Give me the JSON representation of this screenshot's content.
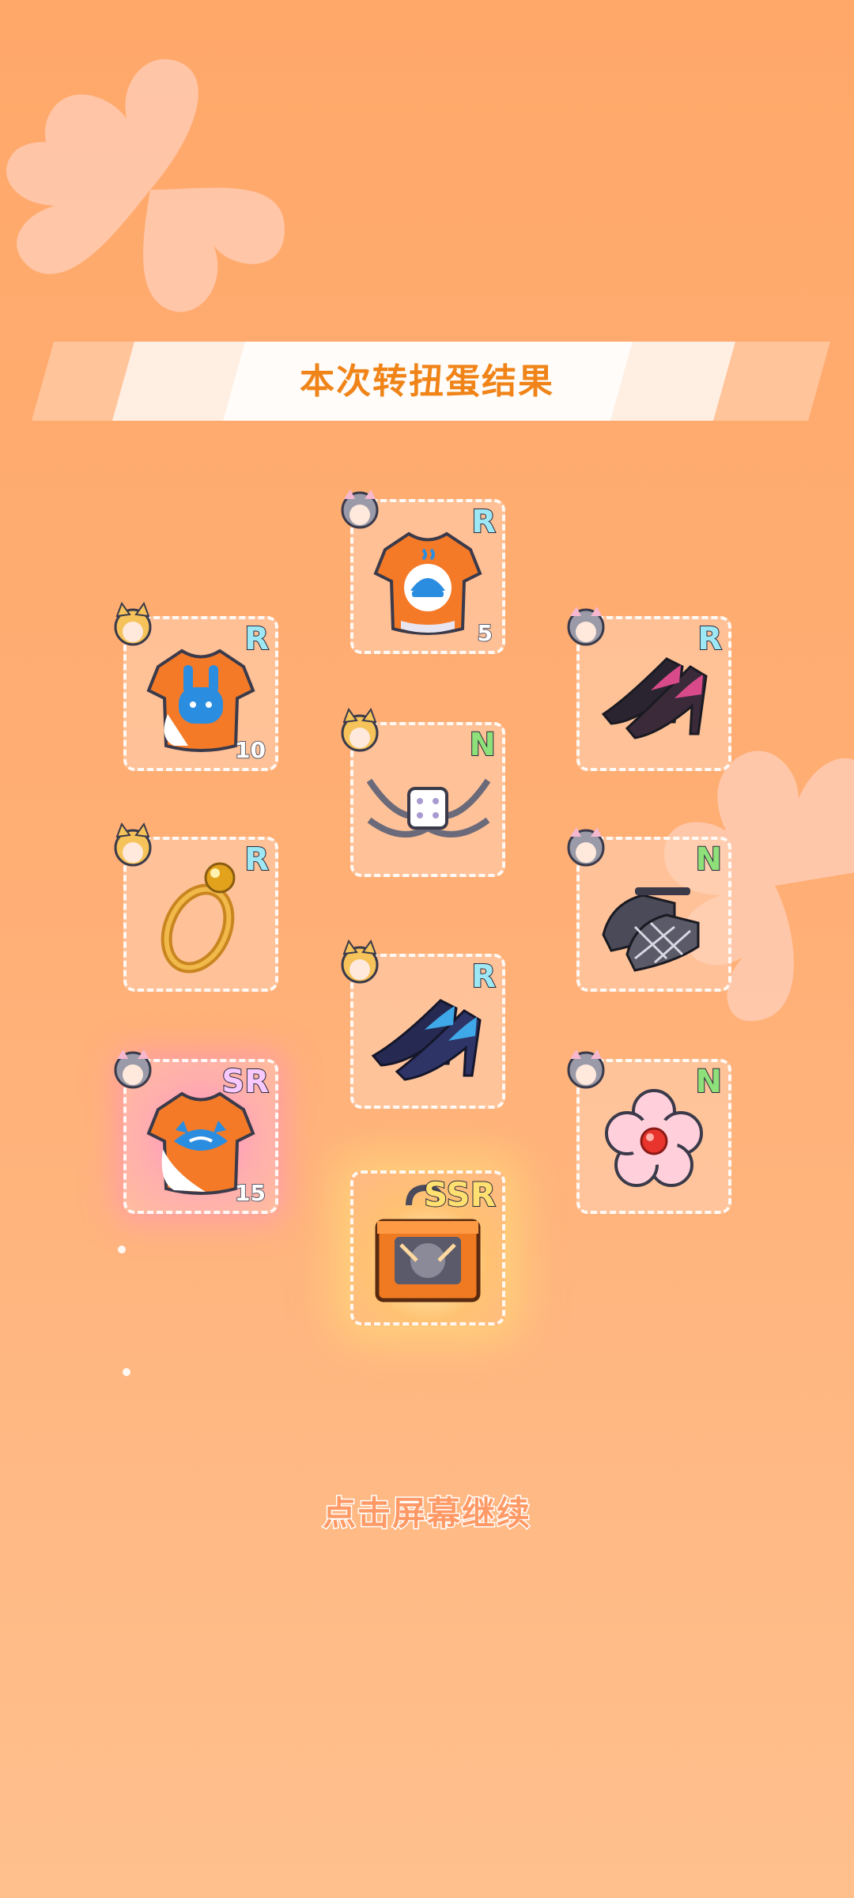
{
  "result_banner": {
    "title": "本次转扭蛋结果"
  },
  "continue_hint": "点击屏幕继续",
  "items": [
    {
      "id": "shirt-bell",
      "name": "bell-shirt",
      "rarity": "R",
      "quantity": "5",
      "avatar": "gray-hair-character"
    },
    {
      "id": "shirt-bunny",
      "name": "bunny-shirt",
      "rarity": "R",
      "quantity": "10",
      "avatar": "blonde-fox-character"
    },
    {
      "id": "heels-pink",
      "name": "pink-heels",
      "rarity": "R",
      "quantity": "",
      "avatar": "gray-hair-character"
    },
    {
      "id": "collar",
      "name": "collar",
      "rarity": "N",
      "quantity": "",
      "avatar": "blonde-fox-character"
    },
    {
      "id": "ring",
      "name": "gold-ring",
      "rarity": "R",
      "quantity": "",
      "avatar": "blonde-fox-character"
    },
    {
      "id": "shoes-plaid",
      "name": "plaid-shoes",
      "rarity": "N",
      "quantity": "",
      "avatar": "gray-hair-character"
    },
    {
      "id": "heels-blue",
      "name": "blue-heels",
      "rarity": "R",
      "quantity": "",
      "avatar": "blonde-fox-character"
    },
    {
      "id": "shirt-cat",
      "name": "cat-shirt",
      "rarity": "SR",
      "quantity": "15",
      "avatar": "gray-hair-character"
    },
    {
      "id": "flower",
      "name": "flower-accessory",
      "rarity": "N",
      "quantity": "",
      "avatar": "gray-hair-character"
    },
    {
      "id": "box",
      "name": "mystery-box",
      "rarity": "SSR",
      "quantity": "",
      "avatar": ""
    }
  ],
  "colors": {
    "accent": "#f08418",
    "background": "#ffa86a",
    "rarity_R": "#9ee8f5",
    "rarity_N": "#8ee07a",
    "rarity_SR": "#f7c9ff",
    "rarity_SSR": "#ffe070"
  }
}
